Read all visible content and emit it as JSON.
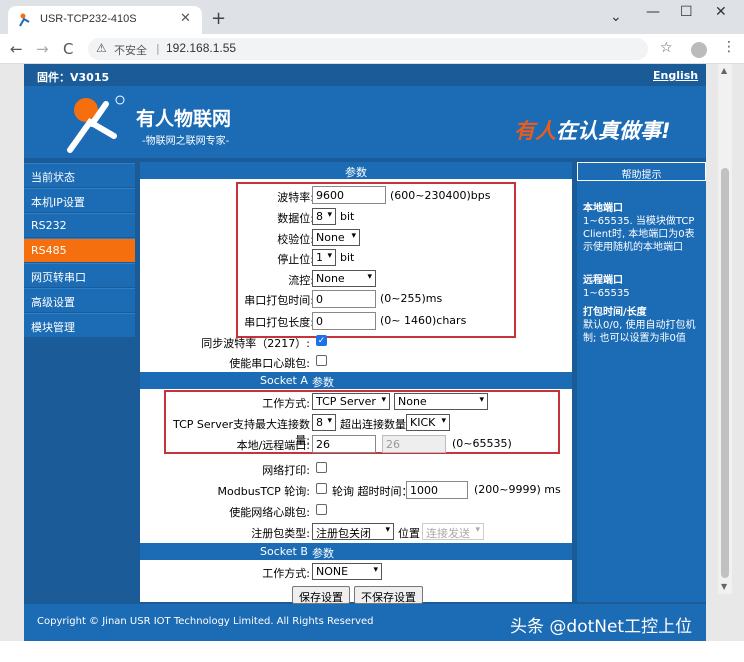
{
  "browser": {
    "tab_title": "USR-TCP232-410S",
    "tab_close": "✕",
    "new_tab": "+",
    "win_min": "—",
    "win_max": "☐",
    "win_close": "✕",
    "win_dropdown": "⌄",
    "back": "←",
    "forward": "→",
    "reload": "C",
    "warning": "⚠",
    "security_label": "不安全",
    "separator": "|",
    "url": "192.168.1.55",
    "star": "☆",
    "menu": "⋮"
  },
  "header": {
    "firmware": "固件：V3015",
    "language": "English",
    "brand_name": "有人物联网",
    "brand_sub": "-物联网之联网专家-",
    "slogan_red": "有人",
    "slogan_rest": "在认真做事!"
  },
  "nav": {
    "items": [
      {
        "label": "当前状态"
      },
      {
        "label": "本机IP设置"
      },
      {
        "label": "RS232"
      },
      {
        "label": "RS485",
        "active": true
      },
      {
        "label": "网页转串口"
      },
      {
        "label": "高级设置"
      },
      {
        "label": "模块管理"
      }
    ]
  },
  "params": {
    "header": "参数",
    "baud_label": "波特率:",
    "baud_value": "9600",
    "baud_range": "(600~230400)bps",
    "databits_label": "数据位:",
    "databits_value": "8",
    "databits_unit": "bit",
    "parity_label": "校验位:",
    "parity_value": "None",
    "stopbits_label": "停止位:",
    "stopbits_value": "1",
    "stopbits_unit": "bit",
    "flow_label": "流控:",
    "flow_value": "None",
    "pack_time_label": "串口打包时间:",
    "pack_time_value": "0",
    "pack_time_range": "(0~255)ms",
    "pack_len_label": "串口打包长度:",
    "pack_len_value": "0",
    "pack_len_range": "(0~ 1460)chars",
    "sync_label": "同步波特率（2217）:",
    "heartbeat_label": "使能串口心跳包:"
  },
  "socket_a": {
    "header_left": "Socket A",
    "header_right": "参数",
    "mode_label": "工作方式:",
    "mode_value": "TCP Server",
    "mode2_value": "None",
    "max_conn_label": "TCP Server支持最大连接数量:",
    "max_conn_value": "8",
    "exceed_label": "超出连接数量",
    "exceed_value": "KICK",
    "port_label": "本地/远程端口:",
    "local_port": "26",
    "remote_port": "26",
    "port_range": "(0~65535)",
    "netprint_label": "网络打印:",
    "modbus_label": "ModbusTCP 轮询:",
    "poll_label": "轮询 超时时间：",
    "timeout_value": "1000",
    "timeout_range": "(200~9999) ms",
    "net_hb_label": "使能网络心跳包:",
    "reg_label": "注册包类型:",
    "reg_value": "注册包关闭",
    "pos_label": "位置",
    "pos_value": "连接发送"
  },
  "socket_b": {
    "header_left": "Socket B",
    "header_right": "参数",
    "mode_label": "工作方式:",
    "mode_value": "NONE"
  },
  "buttons": {
    "save": "保存设置",
    "cancel": "不保存设置"
  },
  "help": {
    "header": "帮助提示",
    "b1_title": "本地端口",
    "b1_text": "1~65535. 当模块做TCP Client时, 本地端口为0表示使用随机的本地端口",
    "b2_title": "远程端口",
    "b2_text": "1~65535",
    "b3_title": "打包时间/长度",
    "b3_text": "默认0/0, 使用自动打包机制; 也可以设置为非0值"
  },
  "footer": {
    "copyright": "Copyright © Jinan USR IOT Technology Limited. All Rights Reserved",
    "watermark": "头条 @dotNet工控上位机"
  },
  "colors": {
    "brand_blue": "#1b6bb5",
    "nav_active": "#f56f0e",
    "highlight_red": "#c8323c"
  }
}
